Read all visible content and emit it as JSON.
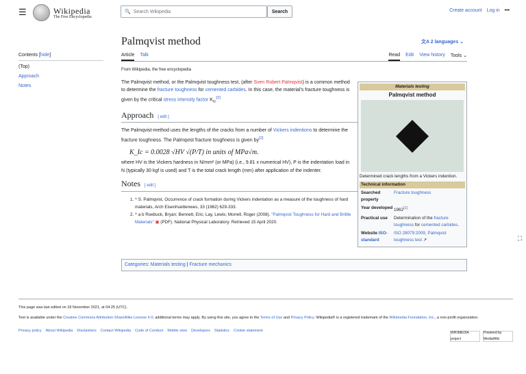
{
  "header": {
    "wordmark": "Wikipedia",
    "tagline": "The Free Encyclopedia",
    "search_placeholder": "Search Wikipedia",
    "search_button": "Search",
    "create_account": "Create account",
    "login": "Log in"
  },
  "toc": {
    "title": "Contents",
    "hide": "hide",
    "items": [
      "(Top)",
      "Approach",
      "Notes"
    ]
  },
  "page": {
    "title": "Palmqvist method",
    "languages": "2 languages",
    "tabs_left": [
      "Article",
      "Talk"
    ],
    "tabs_right": [
      "Read",
      "Edit",
      "View history",
      "Tools"
    ],
    "from": "From Wikipedia, the free encyclopedia"
  },
  "intro": {
    "t1": "The Palmqvist method, or the Palmqvist toughness test, (after ",
    "l1": "Sven Robert Palmqvist",
    "t2": ") is a common method to determine the ",
    "l2": "fracture toughness",
    "t3": " for ",
    "l3": "cemented carbides",
    "t4": ". In this case, the material's fracture toughness is given by the critical ",
    "l4": "stress intensity factor",
    "t5": " K",
    "sub": "Ic",
    "ref": "[2]"
  },
  "approach": {
    "heading": "Approach",
    "edit": "[ edit ]",
    "t1": "The Palmqvist-method uses the lengths of the cracks from a number of ",
    "l1": "Vickers indentions",
    "t2": " to determine the fracture toughness. The Palmqvist fracture toughness is given by",
    "ref": "[2]",
    "formula": "K_Ic = 0.0028 √HV √(P/T)  in units of MPa√m.",
    "after": "where HV is the Vickers hardness in N/mm² (or MPa) (i.e., 9.81 x numerical HV), P is the indentation load in N (typically 30 kgf is used) and T is the total crack length (mm) after application of the indenter."
  },
  "notes": {
    "heading": "Notes",
    "edit": "[ edit ]",
    "n1": "^ S. Palmqvist, Occurrence of crack formation during Vickers indentation as a measure of the toughness of hard materials, Arch Eisenhuettenwes, 33 (1962) 629-333.",
    "n2a": "^ a b Roebuck, Bryan; Bennett, Eric; Lay, Lewis; Morrell, Roger (2008). ",
    "n2l": "\"Palmqvist Toughness for Hard and Brittle Materials\"",
    "n2b": " (PDF). National Physical Laboratory. Retrieved 15 April 2020."
  },
  "infobox": {
    "header": "Materials testing",
    "title": "Palmqvist method",
    "caption": "Determined crack lengths from a Vickers indention.",
    "section": "Technical information",
    "rows": [
      {
        "k": "Searched property",
        "v": "Fracture toughness"
      },
      {
        "k": "Year developed",
        "v": "1962",
        "ref": "[1]"
      },
      {
        "k": "Practical use",
        "v1": "Determination of the ",
        "l1": "fracture toughness",
        "v2": " for ",
        "l2": "cemented carbides",
        "v3": "."
      },
      {
        "k": "Website",
        "kl": "ISO-standard",
        "v": "ISO 28079:2009, Palmqvist toughness test"
      }
    ]
  },
  "categories": {
    "label": "Categories",
    "items": [
      "Materials testing",
      "Fracture mechanics"
    ]
  },
  "footer": {
    "edited": "This page was last edited on 18 November 2021, at 04:25 (UTC).",
    "license1": "Text is available under the ",
    "license_link": "Creative Commons Attribution-ShareAlike License 4.0",
    "license2": "; additional terms may apply. By using this site, you agree to the ",
    "terms": "Terms of Use",
    "and": " and ",
    "privacy": "Privacy Policy",
    "license3": ". Wikipedia® is a registered trademark of the ",
    "wmf": "Wikimedia Foundation, Inc.",
    "license4": ", a non-profit organization.",
    "links": [
      "Privacy policy",
      "About Wikipedia",
      "Disclaimers",
      "Contact Wikipedia",
      "Code of Conduct",
      "Mobile view",
      "Developers",
      "Statistics",
      "Cookie statement"
    ],
    "badge1": "WIKIMEDIA project",
    "badge2": "Powered by MediaWiki"
  }
}
